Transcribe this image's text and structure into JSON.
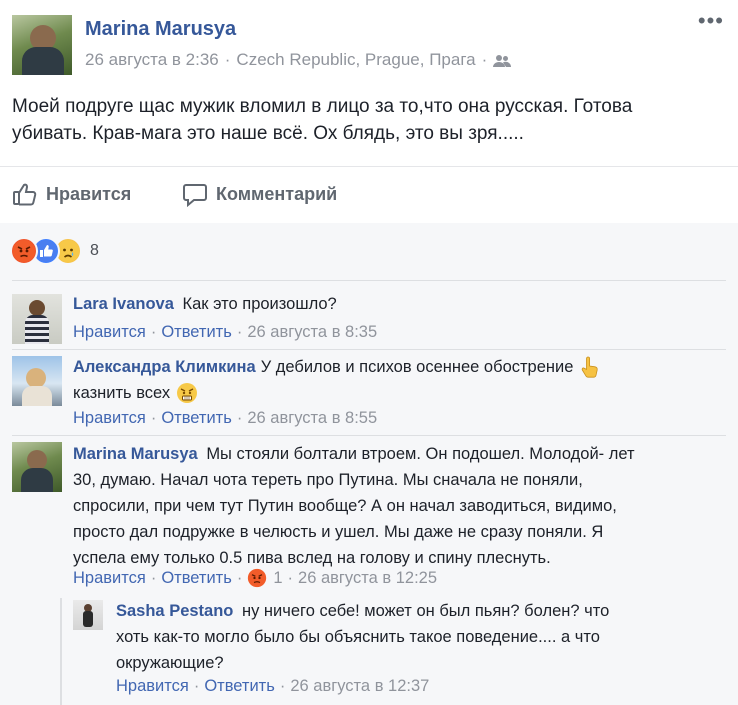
{
  "post": {
    "author": "Marina Marusya",
    "date": "26 августа в 2:36",
    "location": "Czech Republic, Prague, Прага",
    "audience_icon": "friends-icon",
    "text": "Моей подруге щас мужик вломил в лицо за то,что она русская. Готова убивать. Крав-мага это наше всё. Ох блядь, это вы зря....."
  },
  "actions": {
    "like": "Нравится",
    "comment": "Комментарий"
  },
  "reactions": {
    "types": [
      "angry",
      "like",
      "sad"
    ],
    "count": "8"
  },
  "comments": [
    {
      "author": "Lara Ivanova",
      "text": "Как это произошло?",
      "like": "Нравится",
      "reply": "Ответить",
      "time": "26 августа в 8:35"
    },
    {
      "author": "Александра Климкина",
      "text_line1": "У дебилов и психов осеннее обострение",
      "text_line2": "казнить всех",
      "like": "Нравится",
      "reply": "Ответить",
      "time": "26 августа в 8:55"
    },
    {
      "author": "Marina Marusya",
      "lines": [
        "Мы стояли болтали втроем. Он подошел. Молодой- лет",
        "30, думаю. Начал чота тереть про Путина. Мы сначала не поняли,",
        "спросили, при чем тут Путин вообще? А он начал заводиться, видимо,",
        "просто дал подружке в челюсть и ушел. Мы даже не сразу поняли. Я",
        "успела ему только 0.5 пива вслед на голову и спину плеснуть."
      ],
      "like": "Нравится",
      "reply": "Ответить",
      "reaction_count": "1",
      "time": "26 августа в 12:25"
    }
  ],
  "reply": {
    "author": "Sasha Pestano",
    "lines": [
      "ну ничего себе! может он был пьян? болен? что",
      "хоть как-то могло было бы объяснить такое поведение.... а что",
      "окружающие?"
    ],
    "like": "Нравится",
    "reply": "Ответить",
    "time": "26 августа в 12:37"
  },
  "colors": {
    "link": "#365899",
    "action_link": "#4267b2",
    "meta": "#90949c",
    "angry": "#f0542a",
    "like": "#4080ff",
    "sad": "#f7c44a"
  }
}
